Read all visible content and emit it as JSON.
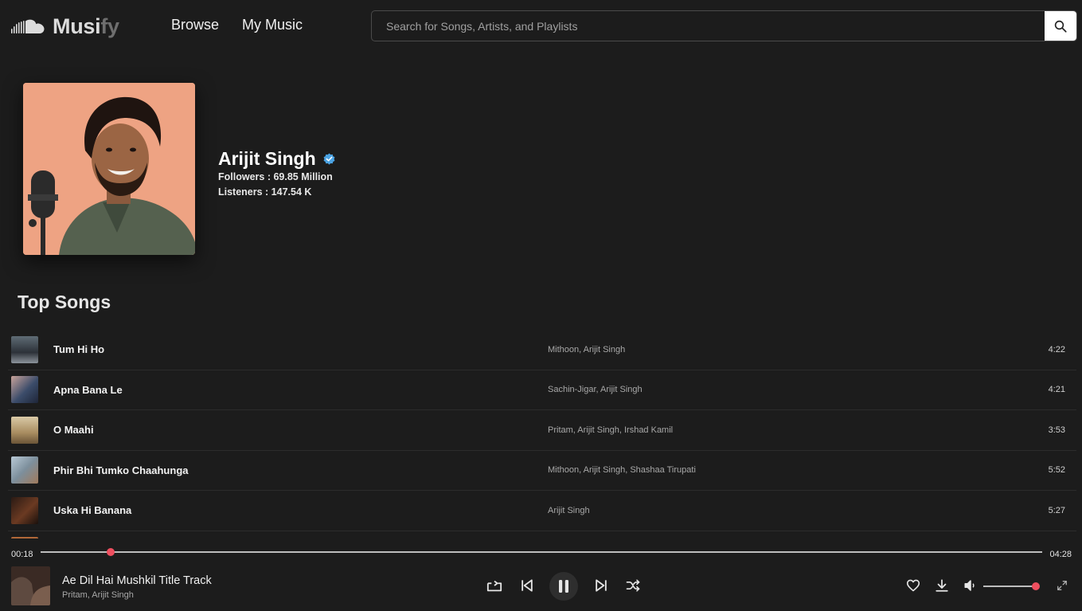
{
  "header": {
    "logo_text_a": "Musi",
    "logo_text_b": "fy",
    "nav": [
      {
        "label": "Browse"
      },
      {
        "label": "My Music"
      }
    ],
    "search_placeholder": "Search for Songs, Artists, and Playlists"
  },
  "artist": {
    "name": "Arijit Singh",
    "followers": "Followers : 69.85 Million",
    "listeners": "Listeners : 147.54 K"
  },
  "section_title": "Top Songs",
  "songs": [
    {
      "title": "Tum Hi Ho",
      "artists": "Mithoon, Arijit Singh",
      "duration": "4:22"
    },
    {
      "title": "Apna Bana Le",
      "artists": "Sachin-Jigar, Arijit Singh",
      "duration": "4:21"
    },
    {
      "title": "O Maahi",
      "artists": "Pritam, Arijit Singh, Irshad Kamil",
      "duration": "3:53"
    },
    {
      "title": "Phir Bhi Tumko Chaahunga",
      "artists": "Mithoon, Arijit Singh, Shashaa Tirupati",
      "duration": "5:52"
    },
    {
      "title": "Uska Hi Banana",
      "artists": "Arijit Singh",
      "duration": "5:27"
    }
  ],
  "player": {
    "current_time": "00:18",
    "total_time": "04:28",
    "progress": 0.07,
    "title": "Ae Dil Hai Mushkil Title Track",
    "artists": "Pritam, Arijit Singh",
    "volume": 1.0,
    "state": "playing"
  },
  "colors": {
    "background": "#1c1c1c",
    "accent": "#ef4f5f",
    "verified": "#4ba3e3"
  }
}
